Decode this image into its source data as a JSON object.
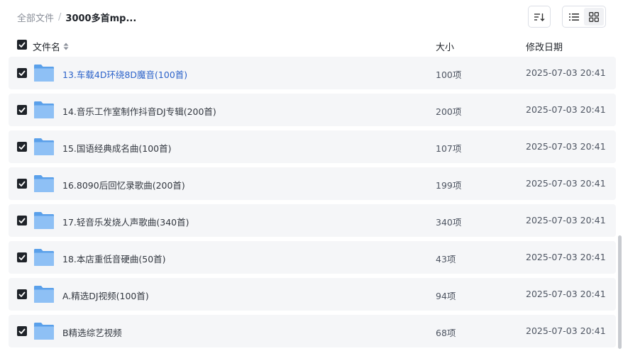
{
  "breadcrumb": {
    "root": "全部文件",
    "separator": "/",
    "current": "3000多首mp..."
  },
  "toolbar": {
    "sort_icon": "sort-descending-icon",
    "list_view_icon": "list-view-icon",
    "grid_view_icon": "grid-view-icon",
    "active_view": "list"
  },
  "columns": {
    "name": "文件名",
    "size": "大小",
    "modified": "修改日期"
  },
  "colors": {
    "checkbox": "#1f2329",
    "row_bg": "#f5f6f8",
    "link": "#2b62c9",
    "folder": "#7fb3f0"
  },
  "files": [
    {
      "name": "13.车载4D环绕8D魔音(100首)",
      "size": "100项",
      "date": "2025-07-03 20:41",
      "checked": true,
      "highlighted": true
    },
    {
      "name": "14.音乐工作室制作抖音DJ专辑(200首)",
      "size": "200项",
      "date": "2025-07-03 20:41",
      "checked": true
    },
    {
      "name": "15.国语经典成名曲(100首)",
      "size": "107项",
      "date": "2025-07-03 20:41",
      "checked": true
    },
    {
      "name": "16.8090后回忆录歌曲(200首)",
      "size": "199项",
      "date": "2025-07-03 20:41",
      "checked": true
    },
    {
      "name": "17.轻音乐发烧人声歌曲(340首)",
      "size": "340项",
      "date": "2025-07-03 20:41",
      "checked": true
    },
    {
      "name": "18.本店重低音硬曲(50首)",
      "size": "43项",
      "date": "2025-07-03 20:41",
      "checked": true
    },
    {
      "name": "A.精选DJ视频(100首)",
      "size": "94项",
      "date": "2025-07-03 20:41",
      "checked": true
    },
    {
      "name": "B精选综艺视频",
      "size": "68项",
      "date": "2025-07-03 20:41",
      "checked": true
    }
  ]
}
